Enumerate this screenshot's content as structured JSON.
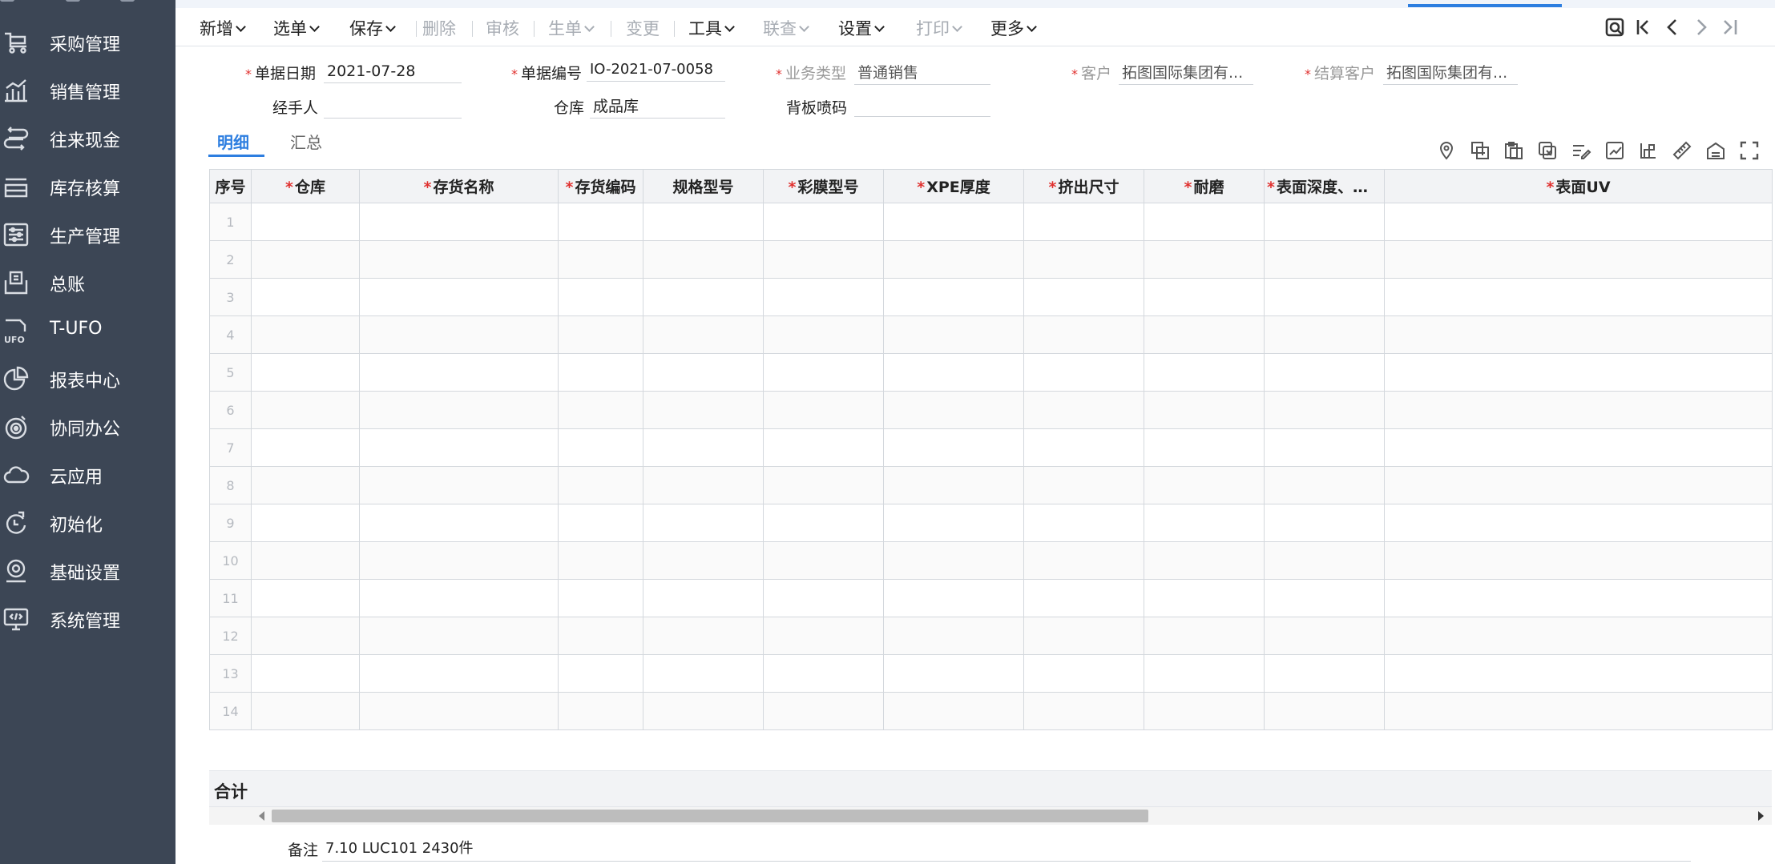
{
  "sidebar": {
    "items": [
      {
        "label": "采购管理",
        "icon": "purchase-icon"
      },
      {
        "label": "销售管理",
        "icon": "sales-chart-icon"
      },
      {
        "label": "往来现金",
        "icon": "cash-flow-icon"
      },
      {
        "label": "库存核算",
        "icon": "inventory-icon"
      },
      {
        "label": "生产管理",
        "icon": "production-icon"
      },
      {
        "label": "总账",
        "icon": "ledger-icon"
      },
      {
        "label": "T-UFO",
        "icon": "ufo-icon"
      },
      {
        "label": "报表中心",
        "icon": "report-pie-icon"
      },
      {
        "label": "协同办公",
        "icon": "collab-icon"
      },
      {
        "label": "云应用",
        "icon": "cloud-icon"
      },
      {
        "label": "初始化",
        "icon": "init-refresh-icon"
      },
      {
        "label": "基础设置",
        "icon": "settings-gear-icon"
      },
      {
        "label": "系统管理",
        "icon": "system-monitor-icon"
      }
    ]
  },
  "toolbar": {
    "new": "新增",
    "select": "选单",
    "save": "保存",
    "delete": "删除",
    "audit": "审核",
    "generate": "生单",
    "change": "变更",
    "tools": "工具",
    "link_query": "联查",
    "settings": "设置",
    "print": "打印",
    "more": "更多"
  },
  "form": {
    "doc_date_label": "单据日期",
    "doc_date": "2021-07-28",
    "doc_no_label": "单据编号",
    "doc_no": "IO-2021-07-0058",
    "biz_type_label": "业务类型",
    "biz_type": "普通销售",
    "customer_label": "客户",
    "customer": "拓图国际集团有...",
    "settle_customer_label": "结算客户",
    "settle_customer": "拓图国际集团有...",
    "handler_label": "经手人",
    "handler": "",
    "warehouse_label": "仓库",
    "warehouse": "成品库",
    "backplate_label": "背板喷码",
    "backplate": ""
  },
  "tabs": {
    "detail": "明细",
    "summary": "汇总"
  },
  "grid": {
    "columns": {
      "seq": "序号",
      "warehouse": "仓库",
      "item_name": "存货名称",
      "item_code": "存货编码",
      "spec": "规格型号",
      "film_model": "彩膜型号",
      "xpe": "XPE厚度",
      "extrude": "挤出尺寸",
      "wear": "耐磨",
      "surface_depth": "表面深度、纹...",
      "surface_uv": "表面UV"
    },
    "row_numbers": [
      "1",
      "2",
      "3",
      "4",
      "5",
      "6",
      "7",
      "8",
      "9",
      "10",
      "11",
      "12",
      "13",
      "14"
    ]
  },
  "footer": {
    "total_label": "合计",
    "remark_label": "备注",
    "remark_value": "7.10  LUC101  2430件"
  },
  "colors": {
    "sidebar_bg": "#3c4655",
    "accent": "#2d7ee0",
    "required": "#e0312f"
  }
}
